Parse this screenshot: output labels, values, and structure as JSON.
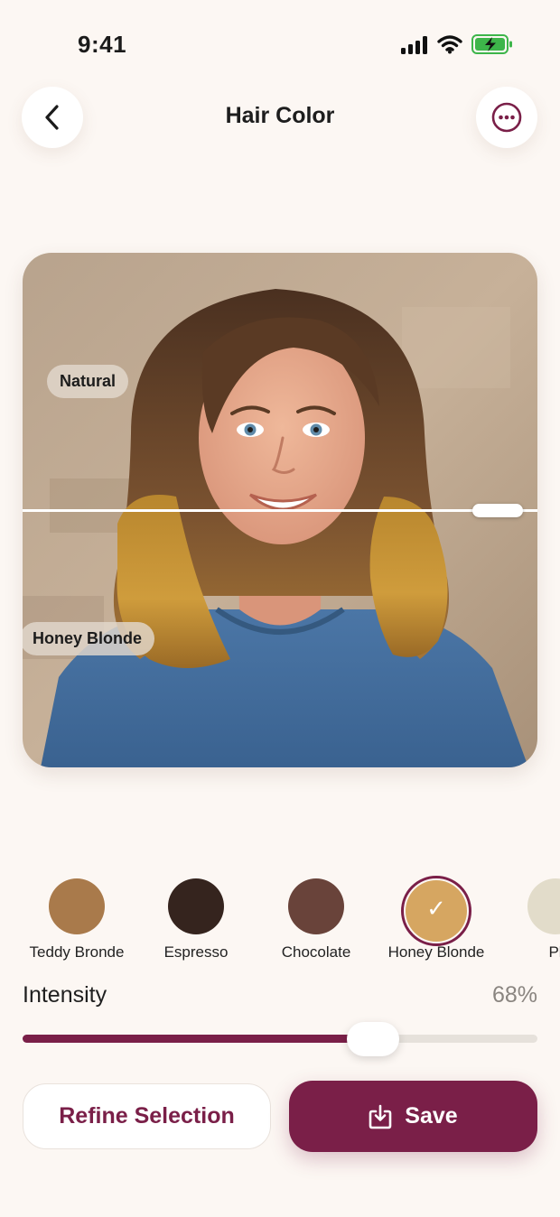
{
  "status_bar": {
    "time": "9:41"
  },
  "header": {
    "title": "Hair Color"
  },
  "photo": {
    "top_label": "Natural",
    "bottom_label": "Honey Blonde"
  },
  "swatches": [
    {
      "name": "Teddy Bronde",
      "color": "#a97a4b",
      "selected": false
    },
    {
      "name": "Espresso",
      "color": "#35241e",
      "selected": false
    },
    {
      "name": "Chocolate",
      "color": "#69433a",
      "selected": false
    },
    {
      "name": "Honey Blonde",
      "color": "#d6a661",
      "selected": true
    },
    {
      "name": "Pl",
      "color": "#e2dcca",
      "selected": false
    }
  ],
  "intensity": {
    "label": "Intensity",
    "value_text": "68%",
    "value": 0.68
  },
  "actions": {
    "refine_label": "Refine Selection",
    "save_label": "Save"
  },
  "colors": {
    "accent": "#7a1f48",
    "background": "#fcf7f3"
  }
}
